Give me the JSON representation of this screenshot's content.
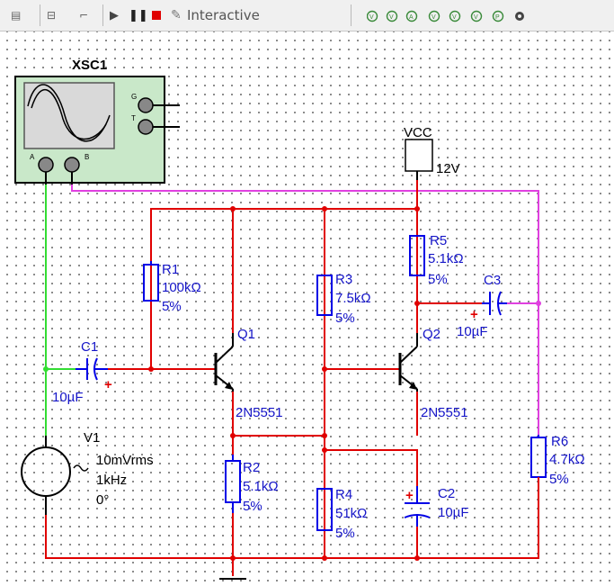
{
  "toolbar": {
    "mode_label": "Interactive"
  },
  "colors": {
    "wire_red": "#e00000",
    "wire_green": "#33dd33",
    "wire_magenta": "#e040e0",
    "component_blue": "#0000e6",
    "scope_green": "#c9e8c9"
  },
  "scope": {
    "name": "XSC1",
    "terminal_g": "G",
    "terminal_t": "T",
    "terminal_a": "A",
    "terminal_b": "B"
  },
  "vcc": {
    "name": "VCC",
    "value": "12V"
  },
  "source": {
    "name": "V1",
    "amplitude": "10mVrms",
    "frequency": "1kHz",
    "phase": "0°"
  },
  "components": {
    "c1": {
      "name": "C1",
      "value": "10µF",
      "polarity": "+"
    },
    "r1": {
      "name": "R1",
      "value": "100kΩ",
      "tol": "5%"
    },
    "q1": {
      "name": "Q1",
      "model": "2N5551"
    },
    "r2": {
      "name": "R2",
      "value": "5.1kΩ",
      "tol": "5%"
    },
    "r3": {
      "name": "R3",
      "value": "7.5kΩ",
      "tol": "5%"
    },
    "r4": {
      "name": "R4",
      "value": "51kΩ",
      "tol": "5%"
    },
    "r5": {
      "name": "R5",
      "value": "5.1kΩ",
      "tol": "5%"
    },
    "q2": {
      "name": "Q2",
      "model": "2N5551"
    },
    "c2": {
      "name": "C2",
      "value": "10µF",
      "polarity": "+"
    },
    "c3": {
      "name": "C3",
      "value": "10µF",
      "polarity": "+"
    },
    "r6": {
      "name": "R6",
      "value": "4.7kΩ",
      "tol": "5%"
    }
  }
}
